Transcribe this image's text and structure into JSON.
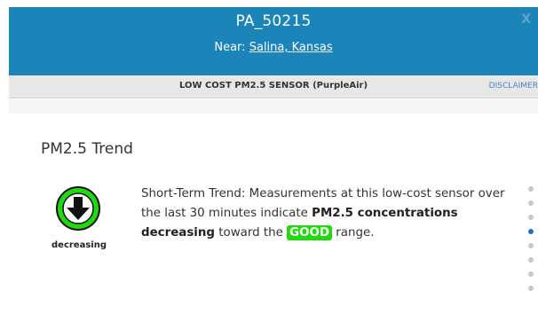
{
  "header": {
    "title": "PA_50215",
    "near_prefix": "Near: ",
    "near_link": "Salina, Kansas",
    "close_label": "X"
  },
  "subbar": {
    "sensor_label": "LOW COST PM2.5 SENSOR (PurpleAir)",
    "disclaimer_label": "DISCLAIMER"
  },
  "trend": {
    "section_title": "PM2.5 Trend",
    "icon_label": "decreasing",
    "text_pre": "Short-Term Trend: Measurements at this low-cost sensor over the last 30 minutes indicate ",
    "text_bold": "PM2.5 concentrations decreasing",
    "text_mid": " toward the ",
    "badge": "GOOD",
    "text_post": " range.",
    "icon_name": "down-arrow-circle-icon",
    "badge_color": "#22d80f"
  },
  "pager": {
    "count": 8,
    "active_index": 3
  },
  "colors": {
    "header_bg": "#1b84b9",
    "good_green": "#22d80f",
    "active_dot": "#1f6fd1"
  }
}
